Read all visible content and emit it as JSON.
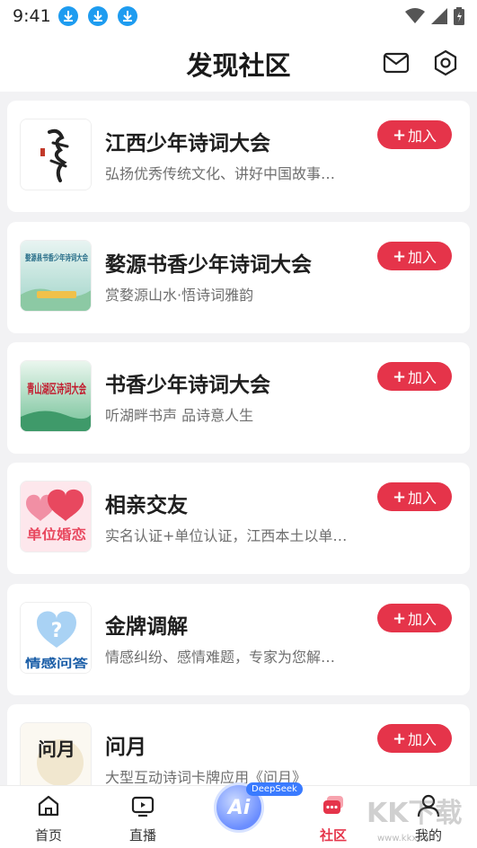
{
  "status_bar": {
    "time": "9:41"
  },
  "header": {
    "title": "发现社区"
  },
  "join_label": "加入",
  "cards": [
    {
      "title": "江西少年诗词大会",
      "desc": "弘扬优秀传统文化、讲好中国故事…"
    },
    {
      "title": "婺源书香少年诗词大会",
      "desc": "赏婺源山水·悟诗词雅韵"
    },
    {
      "title": "书香少年诗词大会",
      "desc": "听湖畔书声 品诗意人生"
    },
    {
      "title": "相亲交友",
      "desc": "实名认证+单位认证，江西本土以单…"
    },
    {
      "title": "金牌调解",
      "desc": "情感纠纷、感情难题，专家为您解…"
    },
    {
      "title": "问月",
      "desc": "大型互动诗词卡牌应用《问月》"
    }
  ],
  "thumbs": {
    "t2": "婺源县书香少年诗词大会",
    "t3": "青山湖区诗词大会",
    "t4": "单位婚恋",
    "t5": "情感问答",
    "t6": "问月"
  },
  "tabbar": {
    "home": "首页",
    "live": "直播",
    "ai": "Ai",
    "deepseek": "DeepSeek",
    "community": "社区",
    "mine": "我的"
  },
  "watermark": {
    "text": "KK下载",
    "url": "www.kkx.net"
  },
  "colors": {
    "accent": "#e5344a",
    "download": "#1e9cf0"
  },
  "icons": [
    "download-icon",
    "wifi-icon",
    "signal-icon",
    "battery-icon",
    "mail-icon",
    "settings-icon",
    "home-icon",
    "live-icon",
    "community-icon",
    "profile-icon"
  ]
}
